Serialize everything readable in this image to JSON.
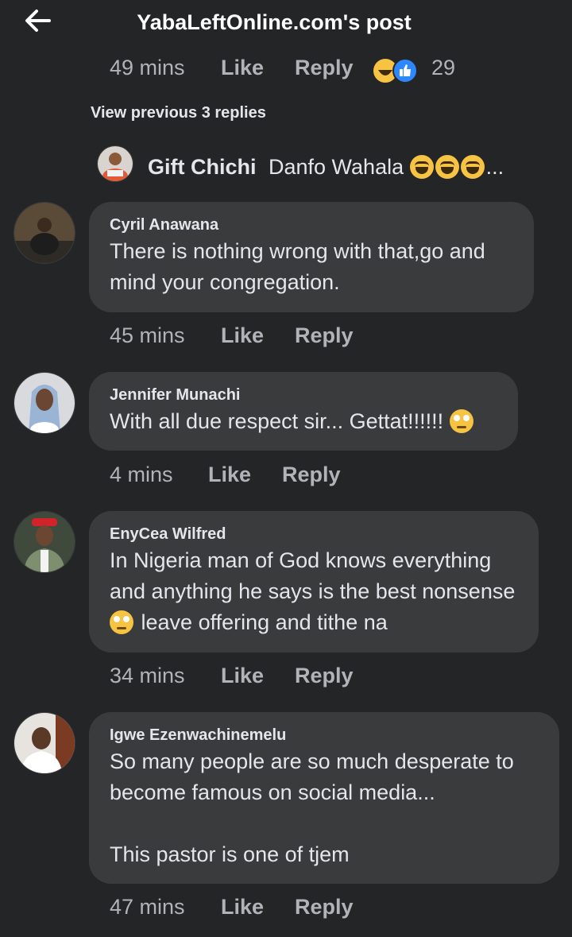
{
  "header": {
    "title": "YabaLeftOnline.com's post"
  },
  "previous_actions": {
    "time": "49 mins",
    "like": "Like",
    "reply": "Reply",
    "reaction_count": "29"
  },
  "view_previous": "View previous 3 replies",
  "reply_preview": {
    "name": "Gift Chichi",
    "text": "Danfo Wahala",
    "ellipsis": "..."
  },
  "comments": [
    {
      "name": "Cyril Anawana",
      "text": "There is nothing wrong with that,go and mind your congregation.",
      "time": "45 mins",
      "like": "Like",
      "reply": "Reply"
    },
    {
      "name": "Jennifer Munachi",
      "text": "With all due respect sir... Gettat!!!!!!",
      "time": "4 mins",
      "like": "Like",
      "reply": "Reply"
    },
    {
      "name": "EnyCea Wilfred",
      "text_a": "In Nigeria man of God knows everything and anything he says is the best nonsense",
      "text_b": "leave offering and tithe na",
      "time": "34 mins",
      "like": "Like",
      "reply": "Reply"
    },
    {
      "name": "Igwe Ezenwachinemelu",
      "text": "So many people are so much desperate to become famous on social media...\n\nThis pastor is one of tjem",
      "time": "47 mins",
      "like": "Like",
      "reply": "Reply"
    }
  ],
  "colors": {
    "background": "#242526",
    "bubble": "#3a3b3c",
    "text": "#e4e6eb",
    "muted": "#b0b3b8",
    "like_blue": "#2d88ff"
  },
  "icons": [
    "back-arrow-icon",
    "haha-reaction-icon",
    "like-reaction-icon",
    "laughing-emoji-icon",
    "eye-roll-emoji-icon"
  ]
}
